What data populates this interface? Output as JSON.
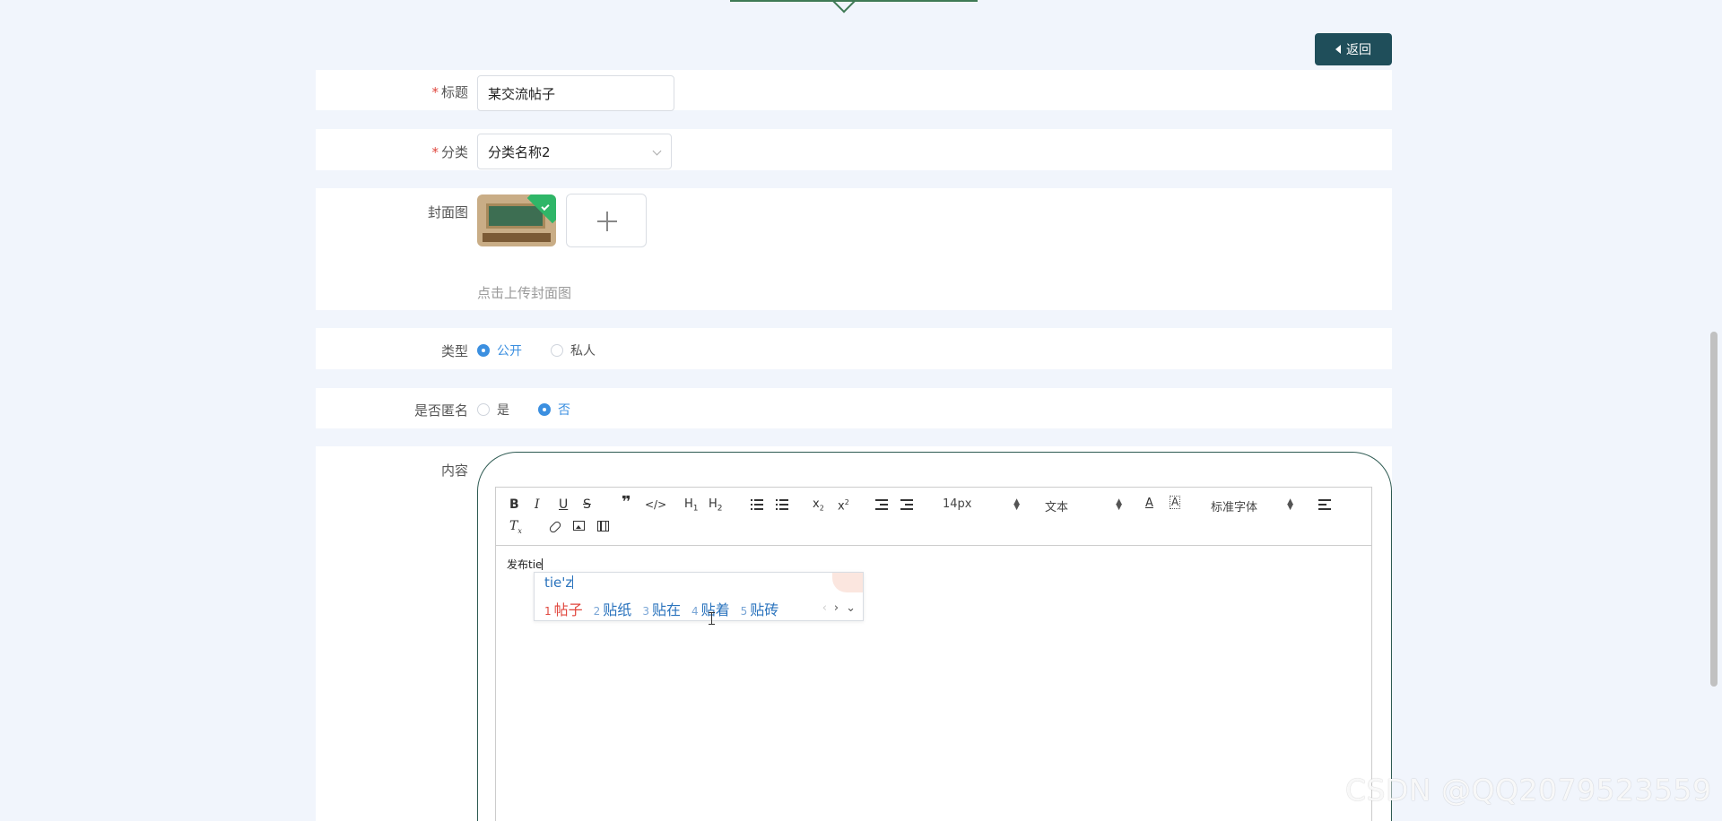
{
  "header": {
    "back_label": "返回"
  },
  "form": {
    "title": {
      "label": "标题",
      "value": "某交流帖子"
    },
    "category": {
      "label": "分类",
      "value": "分类名称2"
    },
    "cover": {
      "label": "封面图",
      "hint": "点击上传封面图"
    },
    "visibility": {
      "label": "类型",
      "options": [
        "公开",
        "私人"
      ],
      "selected": "公开"
    },
    "anonymous": {
      "label": "是否匿名",
      "options": [
        "是",
        "否"
      ],
      "selected": "否"
    },
    "content": {
      "label": "内容",
      "text": "发布tie",
      "toolbar": {
        "font_size": "14px",
        "paragraph": "文本",
        "font_family": "标准字体"
      }
    }
  },
  "ime": {
    "pinyin": "tie'z",
    "candidates": [
      {
        "n": "1",
        "text": "帖子"
      },
      {
        "n": "2",
        "text": "贴纸"
      },
      {
        "n": "3",
        "text": "贴在"
      },
      {
        "n": "4",
        "text": "贴着"
      },
      {
        "n": "5",
        "text": "贴砖"
      }
    ]
  },
  "watermark": "CSDN @QQ2079523559",
  "colors": {
    "accent": "#3b8fe0",
    "back_button": "#1f4e5a",
    "required": "#e0473e"
  }
}
